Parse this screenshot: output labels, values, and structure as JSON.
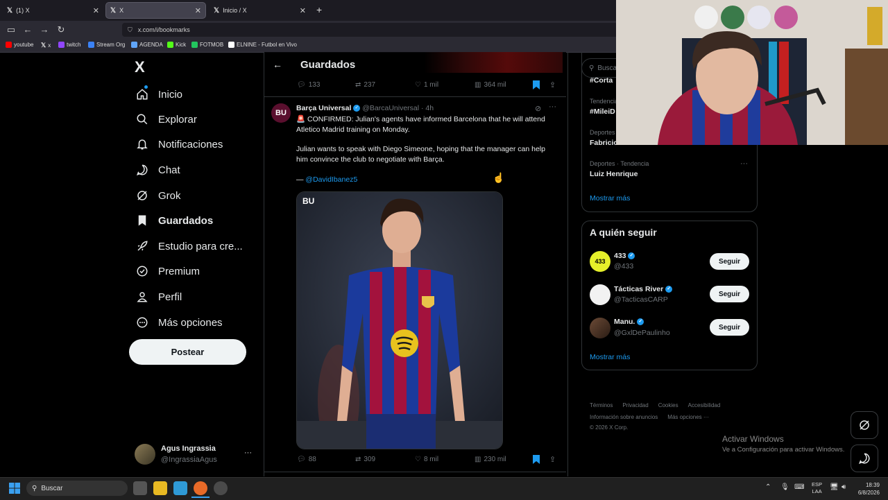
{
  "browser": {
    "tabs": [
      {
        "label": "(1) X"
      },
      {
        "label": "X"
      },
      {
        "label": "Inicio / X"
      }
    ],
    "new_tab": "+",
    "url": "x.com/i/bookmarks",
    "bookmarks": [
      {
        "label": "youtube",
        "color": "#ff0000"
      },
      {
        "label": "x",
        "color": "#ffffff"
      },
      {
        "label": "twitch",
        "color": "#9146ff"
      },
      {
        "label": "Stream Org",
        "color": "#3b82f6"
      },
      {
        "label": "AGENDA",
        "color": "#60a5fa"
      },
      {
        "label": "Kick",
        "color": "#53fc18"
      },
      {
        "label": "FOTMOB",
        "color": "#22c55e"
      },
      {
        "label": "ELNINE - Futbol en Vivo",
        "color": "#ffffff"
      }
    ]
  },
  "sidebar": {
    "logo": "X",
    "items": [
      {
        "label": "Inicio",
        "icon": "home-icon",
        "glyph": "⌂"
      },
      {
        "label": "Explorar",
        "icon": "search-icon",
        "glyph": "⚲"
      },
      {
        "label": "Notificaciones",
        "icon": "bell-icon",
        "glyph": "🔔"
      },
      {
        "label": "Chat",
        "icon": "chat-icon",
        "glyph": "◯"
      },
      {
        "label": "Grok",
        "icon": "grok-icon",
        "glyph": "⊘"
      },
      {
        "label": "Guardados",
        "icon": "bookmark-icon",
        "glyph": "▮"
      },
      {
        "label": "Estudio para cre...",
        "icon": "rocket-icon",
        "glyph": "➶"
      },
      {
        "label": "Premium",
        "icon": "premium-icon",
        "glyph": "✓"
      },
      {
        "label": "Perfil",
        "icon": "person-icon",
        "glyph": "👤"
      },
      {
        "label": "Más opciones",
        "icon": "more-circle-icon",
        "glyph": "⋯"
      }
    ],
    "post_button": "Postear",
    "account": {
      "name": "Agus Ingrassia",
      "handle": "@IngrassiaAgus",
      "more": "···"
    }
  },
  "main": {
    "title": "Guardados",
    "back": "←",
    "prev_actions": {
      "replies": "133",
      "reposts": "237",
      "likes": "1 mil",
      "views": "364 mil"
    },
    "tweet": {
      "author": "Barça Universal",
      "handle": "@BarcaUniversal",
      "time": "· 4h",
      "avatar_text": "BU",
      "paragraph1": "🚨 CONFIRMED: Julian's agents have informed Barcelona that he will attend Atletico Madrid training on Monday.",
      "paragraph2": "Julian wants to speak with Diego Simeone, hoping that the manager can help him convince the club to negotiate with Barça.",
      "credit_prefix": "— ",
      "credit_link": "@DavidIbanez5",
      "image_watermark": "BU",
      "replies": "88",
      "reposts": "309",
      "likes": "8 mil",
      "views": "230 mil"
    }
  },
  "right": {
    "search_placeholder": "Busca",
    "trends": [
      {
        "meta": "",
        "name": "#Corta"
      },
      {
        "meta": "Tendencia",
        "name": "#MileiD"
      },
      {
        "meta": "Deportes",
        "name": "Fabricio Bustos"
      },
      {
        "meta": "Deportes · Tendencia",
        "name": "Luiz Henrique"
      }
    ],
    "show_more_trends": "Mostrar más",
    "who_to_follow": {
      "title": "A quién seguir",
      "accounts": [
        {
          "name": "433",
          "handle": "@433",
          "button": "Seguir"
        },
        {
          "name": "Tácticas River",
          "handle": "@TacticasCARP",
          "button": "Seguir"
        },
        {
          "name": "Manu.",
          "handle": "@GxlDePaulinho",
          "button": "Seguir"
        }
      ],
      "show_more": "Mostrar más"
    },
    "footer": {
      "line1": [
        "Términos",
        "Privacidad",
        "Cookies",
        "Accesibilidad"
      ],
      "line2": [
        "Información sobre anuncios",
        "Más opciones ···"
      ],
      "copyright": "© 2026 X Corp."
    }
  },
  "windows": {
    "activate_title": "Activar Windows",
    "activate_sub": "Ve a Configuración para activar Windows.",
    "search": "Buscar",
    "lang1": "ESP",
    "lang2": "LAA",
    "time": "18:39",
    "date": "6/8/2026"
  }
}
